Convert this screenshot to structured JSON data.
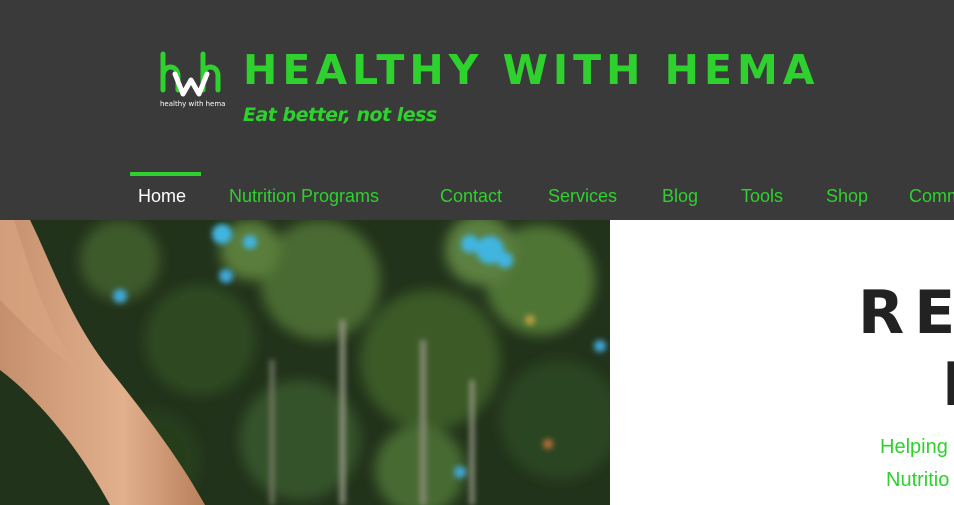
{
  "header": {
    "logo_text": "healthy with hema",
    "brand_title": "HEALTHY WITH HEMA",
    "tagline": "Eat better, not less"
  },
  "nav": {
    "items": [
      {
        "label": "Home",
        "active": true
      },
      {
        "label": "Nutrition Programs"
      },
      {
        "label": "Contact"
      },
      {
        "label": "Services"
      },
      {
        "label": "Blog"
      },
      {
        "label": "Tools"
      },
      {
        "label": "Shop"
      },
      {
        "label": "Comm"
      }
    ]
  },
  "hero": {
    "title_line1": "RE",
    "title_line2": "I",
    "subtitle_line1": "Helping",
    "subtitle_line2": "Nutritio"
  },
  "colors": {
    "header_bg": "#3a3a3a",
    "accent_green": "#2ed12e",
    "title_dark": "#222222"
  }
}
